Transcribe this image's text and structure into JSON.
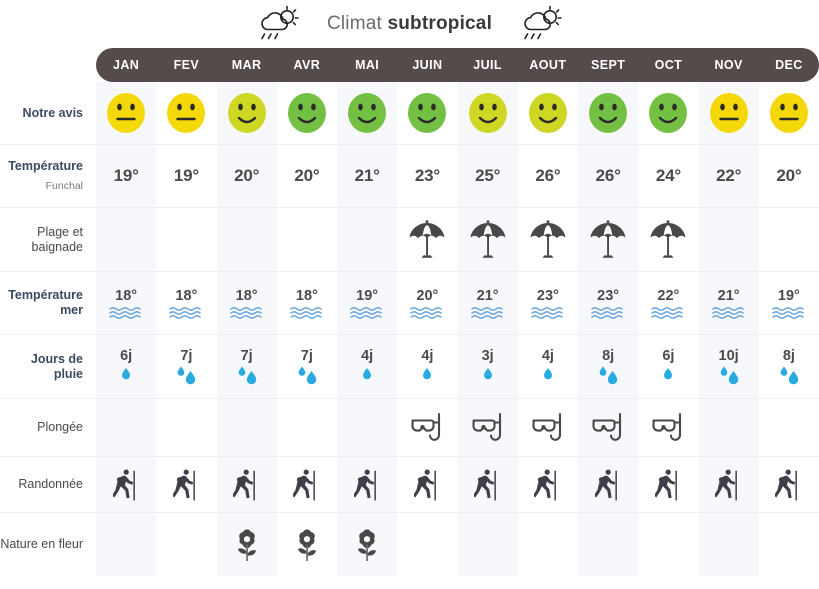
{
  "header": {
    "title_prefix": "Climat ",
    "title_strong": "subtropical",
    "left_icon": "sun-cloud-rain-icon",
    "right_icon": "sun-cloud-rain-icon"
  },
  "table": {
    "corner_label": "",
    "months": [
      "JAN",
      "FEV",
      "MAR",
      "AVR",
      "MAI",
      "JUIN",
      "JUIL",
      "AOUT",
      "SEPT",
      "OCT",
      "NOV",
      "DEC"
    ],
    "rows": [
      {
        "key": "notre_avis",
        "label": "Notre avis",
        "sublabel": "",
        "type": "smiley",
        "values": [
          "yellow-neutral",
          "yellow-neutral",
          "yellowgreen-smile",
          "green-smile",
          "green-smile",
          "green-smile",
          "yellowgreen-smile",
          "yellowgreen-smile",
          "green-smile",
          "green-smile",
          "yellow-neutral",
          "yellow-neutral"
        ]
      },
      {
        "key": "temperature",
        "label": "Température",
        "sublabel": "Funchal",
        "type": "temp",
        "values": [
          "19°",
          "19°",
          "20°",
          "20°",
          "21°",
          "23°",
          "25°",
          "26°",
          "26°",
          "24°",
          "22°",
          "20°"
        ]
      },
      {
        "key": "plage_baignade",
        "label": "Plage et baignade",
        "sublabel": "",
        "type": "icon",
        "icon": "beach-umbrella-icon",
        "values": [
          "",
          "",
          "",
          "",
          "",
          "umbrella",
          "umbrella",
          "umbrella",
          "umbrella",
          "umbrella",
          "",
          ""
        ]
      },
      {
        "key": "temperature_mer",
        "label": "Température mer",
        "sublabel": "",
        "type": "sea",
        "values": [
          "18°",
          "18°",
          "18°",
          "18°",
          "19°",
          "20°",
          "21°",
          "23°",
          "23°",
          "22°",
          "21°",
          "19°"
        ]
      },
      {
        "key": "jours_de_pluie",
        "label": "Jours de pluie",
        "sublabel": "",
        "type": "rain",
        "values": [
          "6j",
          "7j",
          "7j",
          "7j",
          "4j",
          "4j",
          "3j",
          "4j",
          "8j",
          "6j",
          "10j",
          "8j"
        ],
        "drop_counts": [
          1,
          2,
          2,
          2,
          1,
          1,
          1,
          1,
          2,
          1,
          2,
          2
        ]
      },
      {
        "key": "plongee",
        "label": "Plongée",
        "sublabel": "",
        "type": "icon",
        "icon": "diving-mask-icon",
        "values": [
          "",
          "",
          "",
          "",
          "",
          "mask",
          "mask",
          "mask",
          "mask",
          "mask",
          "",
          ""
        ]
      },
      {
        "key": "randonnee",
        "label": "Randonnée",
        "sublabel": "",
        "type": "icon",
        "icon": "hiker-icon",
        "values": [
          "hiker",
          "hiker",
          "hiker",
          "hiker",
          "hiker",
          "hiker",
          "hiker",
          "hiker",
          "hiker",
          "hiker",
          "hiker",
          "hiker"
        ]
      },
      {
        "key": "nature_en_fleur",
        "label": "Nature en fleur",
        "sublabel": "",
        "type": "icon",
        "icon": "flower-icon",
        "values": [
          "",
          "",
          "flower",
          "flower",
          "flower",
          "",
          "",
          "",
          "",
          "",
          "",
          ""
        ]
      }
    ]
  },
  "colors": {
    "header_bar": "#554b4b",
    "row_label": "#3c4a63",
    "value_text": "#4b4b4b",
    "smiley_yellow": "#f5d80a",
    "smiley_yellowgreen": "#cdd724",
    "smiley_green": "#74c043",
    "water_blue": "#6fa8dc",
    "drop_blue": "#29abe2",
    "icon_dark": "#484848",
    "odd_column": "#f7f8fc",
    "even_column": "#ffffff"
  }
}
